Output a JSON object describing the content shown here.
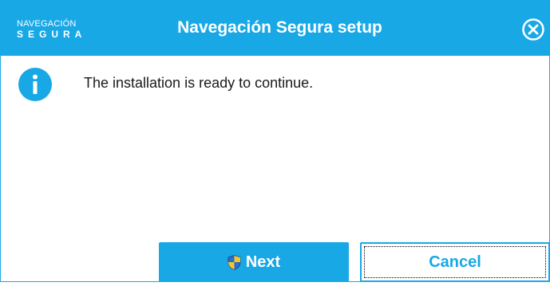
{
  "window": {
    "title": "Navegación Segura setup",
    "logo": {
      "line1": "NAVEGACIÓN",
      "line2": "SEGURA"
    },
    "close_icon": "close-circle-icon"
  },
  "content": {
    "icon": "info-icon",
    "message": "The installation is ready to continue."
  },
  "buttons": {
    "next_label": "Next",
    "next_icon": "uac-shield-icon",
    "cancel_label": "Cancel"
  },
  "colors": {
    "accent": "#19a8e6",
    "text": "#1a1a1a",
    "background": "#ffffff"
  }
}
